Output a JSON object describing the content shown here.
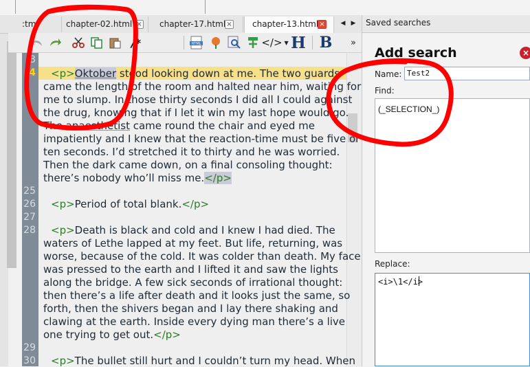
{
  "tabs": [
    {
      "label": ":tml"
    },
    {
      "label": "chapter-02.html"
    },
    {
      "label": "chapter-17.html"
    },
    {
      "label": "chapter-13.html"
    }
  ],
  "tabs_close_glyph": "×",
  "nav_glyphs": {
    "left": "◀",
    "right": "▶",
    "more": "»"
  },
  "panel_glyphs": {
    "float": "□",
    "close": "×"
  },
  "toolbar": {
    "comment_label": "/*",
    "heading_label": "H",
    "bold_label": "B",
    "html_badge": "HTML",
    "code_label": "</>"
  },
  "saved_searches": {
    "title": "Saved searches",
    "add_title": "Add search",
    "name_label": "Name:",
    "name_value": "Test2",
    "find_label": "Find:",
    "find_value": "(_SELECTION_)",
    "replace_label": "Replace:",
    "replace_value": "<i>\\1</i>",
    "close_glyph": "×"
  },
  "editor": {
    "line_numbers": [
      "3",
      "4",
      "25",
      "26",
      "27",
      "28",
      "29",
      "30"
    ],
    "tag_open": "<p>",
    "tag_close": "</p>",
    "para1": {
      "first_word": "Oktober",
      "l1_rest": " stood looking down at me. The two guards",
      "l2": "came the length of the room and halted near him, waiting for",
      "l3": "me to slump. In those thirty seconds I did all I could against",
      "l4": "the drug, knowing that if I let it win my last hope would go.",
      "l5a": "The ",
      "l5b": "anaesthetist",
      "l5c": " came round the chair and eyed me",
      "l6": "impatiently and I knew that the reaction-time must be five or",
      "l7": "ten seconds. I’d stretched it to thirty and he was worried.",
      "l8": "Then the dark came down, on a final consoling thought:",
      "l9": "there’s nobody who’ll miss me."
    },
    "para2": "Period of total blank.",
    "para3": {
      "l1": "Death is black and cold and I knew I had died. The",
      "l2": "waters of Lethe lapped at my feet. But life, returning, was",
      "l3": "worse, because of the cold. It was colder than death. My face",
      "l4": "was pressed to the earth and I lifted it and saw the lights",
      "l5": "along the bridge. A few sick seconds of irrational thought:",
      "l6": "then there’s a life after death and it looks just the same, so",
      "l7": "forth, then the shivers began and I lay there shaking and",
      "l8": "clawing at the earth. Inside every dying man there’s a live",
      "l9": "one trying to get out."
    },
    "para4": "The bullet still hurt and I couldn’t turn my head. When"
  },
  "colors": {
    "annotation": "#ff0000",
    "tag_green": "#2c7a2c",
    "current_line": "#f7e08a",
    "gutter": "#7f8b96"
  }
}
